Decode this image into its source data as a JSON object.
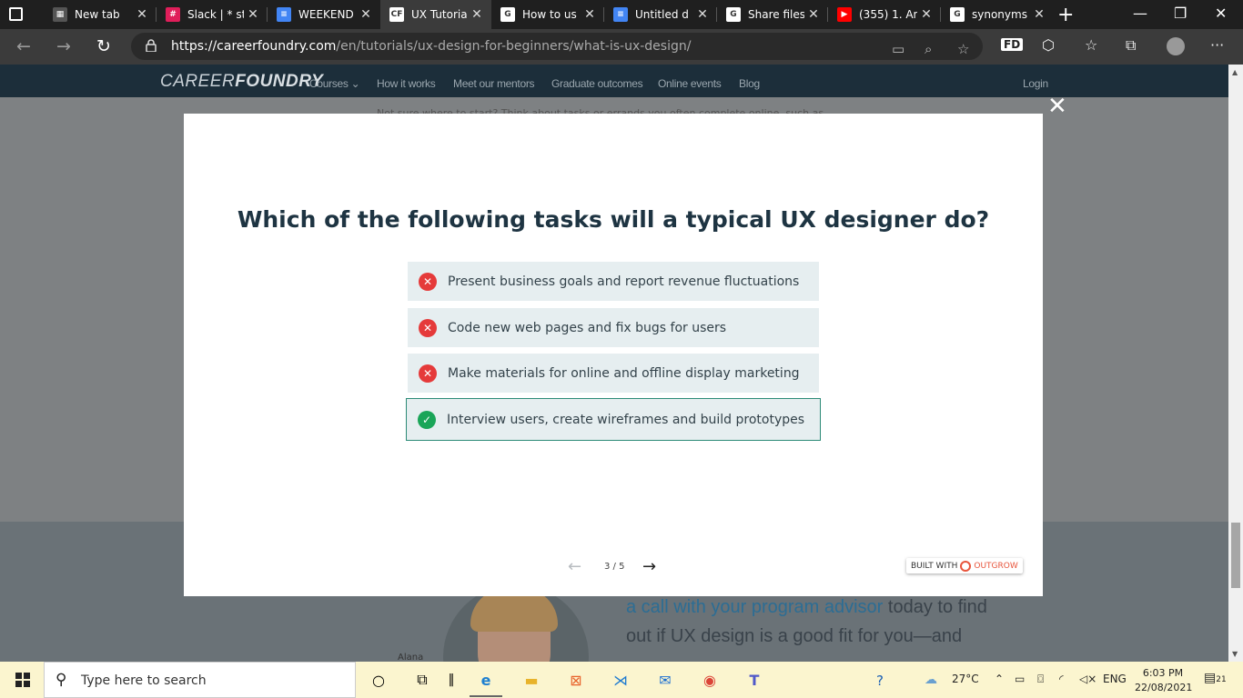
{
  "browser": {
    "tabs": [
      {
        "title": "New tab",
        "icon": "newtab-icon",
        "color": "#555555",
        "glyph": "▦"
      },
      {
        "title": "Slack | * st",
        "icon": "slack-icon",
        "color": "#e01e5a",
        "glyph": "#"
      },
      {
        "title": "WEEKEND",
        "icon": "docs-icon",
        "color": "#4285f4",
        "glyph": "≡"
      },
      {
        "title": "UX Tutoria",
        "icon": "careerfoundry-icon",
        "color": "#ffffff",
        "glyph": "CF"
      },
      {
        "title": "How to us",
        "icon": "google-icon",
        "color": "#ffffff",
        "glyph": "G"
      },
      {
        "title": "Untitled d",
        "icon": "docs-icon",
        "color": "#4285f4",
        "glyph": "≡"
      },
      {
        "title": "Share files",
        "icon": "google-icon",
        "color": "#ffffff",
        "glyph": "G"
      },
      {
        "title": "(355) 1. An",
        "icon": "youtube-icon",
        "color": "#ff0000",
        "glyph": "▶"
      },
      {
        "title": "synonyms",
        "icon": "google-icon",
        "color": "#ffffff",
        "glyph": "G"
      }
    ],
    "url_host": "https://careerfoundry.com",
    "url_path": "/en/tutorials/ux-design-for-beginners/what-is-ux-design/",
    "profile_badge": "FD"
  },
  "site": {
    "logo_light": "CAREER",
    "logo_bold": "FOUNDRY",
    "nav": [
      "Courses ⌄",
      "How it works",
      "Meet our mentors",
      "Graduate outcomes",
      "Online events",
      "Blog"
    ],
    "login": "Login",
    "bg_text_top": "Not sure where to start? Think about tasks or errands you often complete online, such as",
    "cta_line1_hl": "a call with your program advisor",
    "cta_line1_rest": " today to find",
    "cta_line2": "out if UX design is a good fit for you—and",
    "avatar_name": "Alana"
  },
  "quiz": {
    "question": "Which of the following tasks will a typical UX designer do?",
    "options": [
      {
        "text": "Present business goals and report revenue fluctuations",
        "correct": false
      },
      {
        "text": "Code new web pages and fix bugs for users",
        "correct": false
      },
      {
        "text": "Make materials for online and offline display marketing",
        "correct": false
      },
      {
        "text": "Interview users, create wireframes and build prototypes",
        "correct": true
      }
    ],
    "page_indicator": "3 / 5",
    "built_with": "BUILT WITH",
    "built_brand": "OUTGROW",
    "close_glyph": "✕"
  },
  "taskbar": {
    "search_placeholder": "Type here to search",
    "weather": "27°C",
    "language": "ENG",
    "time": "6:03 PM",
    "date": "22/08/2021",
    "notification_count": "21"
  }
}
